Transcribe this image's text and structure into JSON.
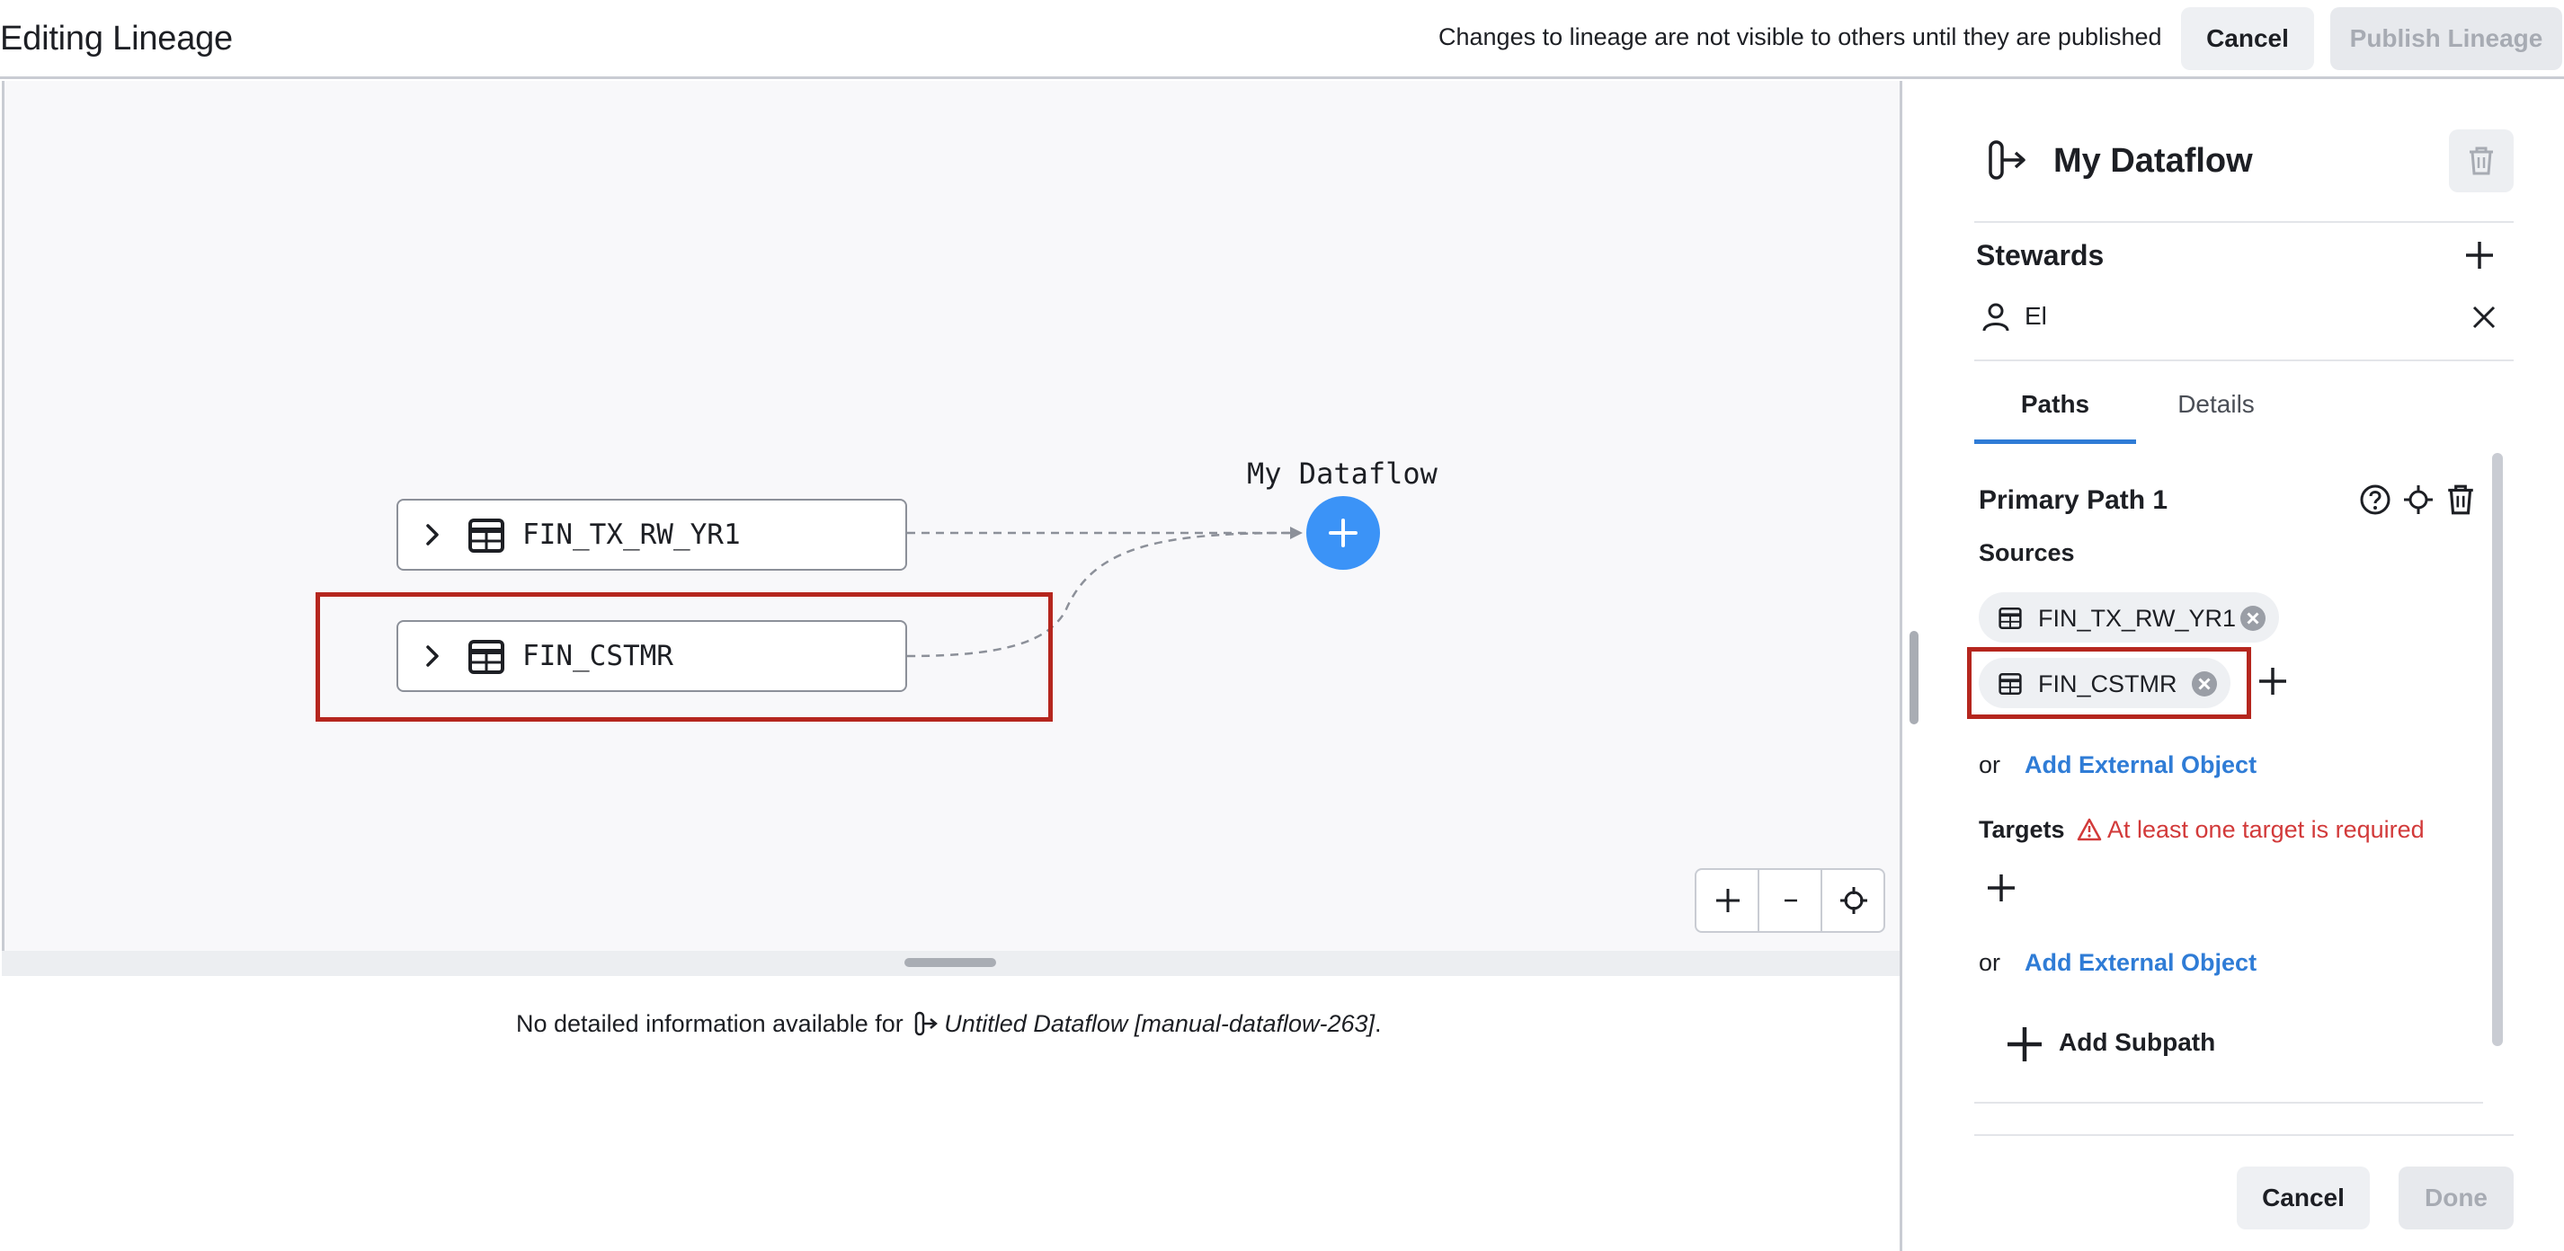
{
  "header": {
    "title": "Editing Lineage",
    "notice": "Changes to lineage are not visible to others until they are published",
    "cancel_label": "Cancel",
    "publish_label": "Publish Lineage"
  },
  "canvas": {
    "nodes": [
      {
        "label": "FIN_TX_RW_YR1",
        "icon": "table-icon"
      },
      {
        "label": "FIN_CSTMR",
        "icon": "table-icon"
      }
    ],
    "dataflow_label": "My Dataflow",
    "zoom_controls": [
      "zoom-in-icon",
      "zoom-out-icon",
      "fit-view-icon"
    ]
  },
  "details_pane": {
    "message_prefix": "No detailed information available for",
    "dataflow_name": "Untitled Dataflow [manual-dataflow-263]",
    "message_suffix": "."
  },
  "panel": {
    "title": "My Dataflow",
    "stewards": {
      "title": "Stewards",
      "users": [
        "El"
      ]
    },
    "tabs": [
      "Paths",
      "Details"
    ],
    "active_tab": "Paths",
    "path": {
      "title": "Primary Path 1",
      "sources_label": "Sources",
      "sources": [
        "FIN_TX_RW_YR1",
        "FIN_CSTMR"
      ],
      "or_label": "or",
      "add_external_label": "Add External Object",
      "targets_label": "Targets",
      "targets_warning": "At least one target is required",
      "add_subpath_label": "Add Subpath"
    },
    "footer": {
      "cancel_label": "Cancel",
      "done_label": "Done"
    }
  },
  "colors": {
    "accent": "#2f7cd6",
    "dataflow_node": "#3b93f7",
    "warning": "#d23a3a",
    "highlight": "#b5261e"
  }
}
